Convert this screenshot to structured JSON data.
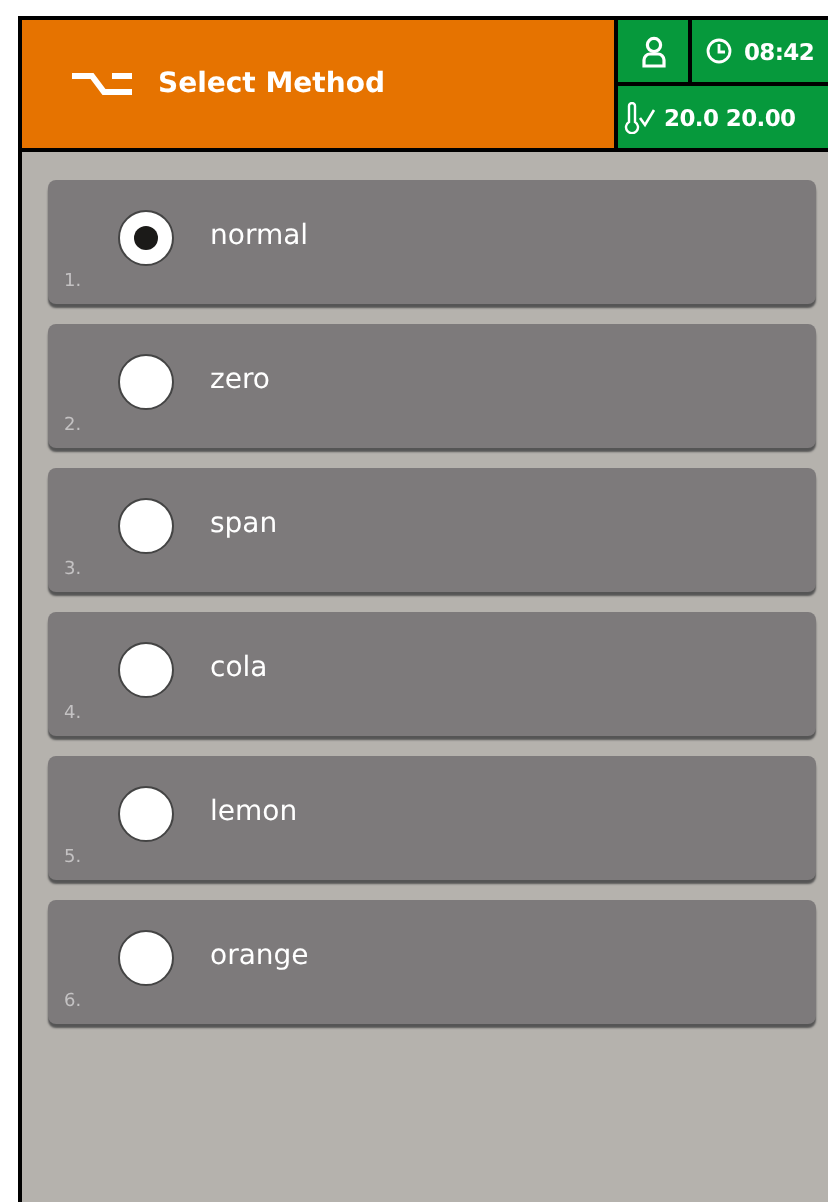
{
  "header": {
    "title": "Select Method",
    "time": "08:42",
    "temperature": "20.0 20.00",
    "temperature_ok": true
  },
  "methods": [
    {
      "number": "1.",
      "name": "normal",
      "selected": true
    },
    {
      "number": "2.",
      "name": "zero",
      "selected": false
    },
    {
      "number": "3.",
      "name": "span",
      "selected": false
    },
    {
      "number": "4.",
      "name": "cola",
      "selected": false
    },
    {
      "number": "5.",
      "name": "lemon",
      "selected": false
    },
    {
      "number": "6.",
      "name": "orange",
      "selected": false
    }
  ]
}
